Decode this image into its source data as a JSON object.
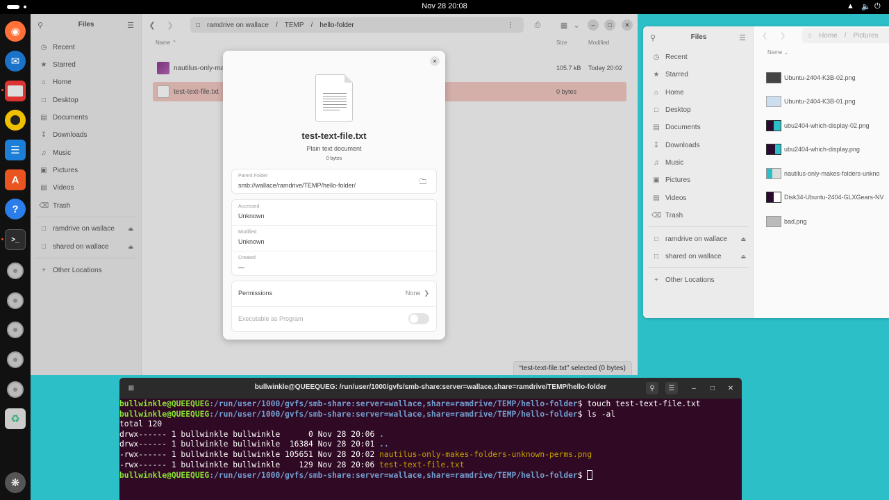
{
  "topbar": {
    "clock": "Nov 28  20:08",
    "icons": [
      "network-icon",
      "volume-icon",
      "power-icon"
    ]
  },
  "dock": {
    "apps": [
      "firefox-icon",
      "thunderbird-icon",
      "files-icon",
      "rhythmbox-icon",
      "writer-icon",
      "app-center-icon",
      "help-icon",
      "terminal-icon",
      "disc-icon",
      "disc-icon",
      "disc-icon",
      "disc-icon",
      "disc-icon",
      "trash-icon",
      "show-apps-icon"
    ]
  },
  "files_left": {
    "sidebar_title": "Files",
    "nav": [
      "Recent",
      "Starred",
      "Home",
      "Desktop",
      "Documents",
      "Downloads",
      "Music",
      "Pictures",
      "Videos",
      "Trash"
    ],
    "mounts": [
      "ramdrive on wallace",
      "shared on wallace"
    ],
    "other": "Other Locations",
    "path": [
      "ramdrive on wallace",
      "TEMP",
      "hello-folder"
    ],
    "columns": {
      "name": "Name",
      "size": "Size",
      "modified": "Modified"
    },
    "rows": [
      {
        "name": "nautilus-only-ma",
        "size": "105.7 kB",
        "modified": "Today 20:02"
      },
      {
        "name": "test-text-file.txt",
        "size": "0 bytes",
        "modified": ""
      }
    ],
    "status": "“test-text-file.txt” selected  (0 bytes)"
  },
  "properties": {
    "file_name": "test-text-file.txt",
    "file_type": "Plain text document",
    "file_size": "0 bytes",
    "parent_folder_label": "Parent Folder",
    "parent_folder": "smb://wallace/ramdrive/TEMP/hello-folder/",
    "accessed_label": "Accessed",
    "accessed": "Unknown",
    "modified_label": "Modified",
    "modified": "Unknown",
    "created_label": "Created",
    "created": "—",
    "permissions_label": "Permissions",
    "permissions_value": "None",
    "executable_label": "Executable as Program"
  },
  "files_right": {
    "sidebar_title": "Files",
    "nav": [
      "Recent",
      "Starred",
      "Home",
      "Desktop",
      "Documents",
      "Downloads",
      "Music",
      "Pictures",
      "Videos",
      "Trash"
    ],
    "mounts": [
      "ramdrive on wallace",
      "shared on wallace"
    ],
    "other": "Other Locations",
    "path": [
      "Home",
      "Pictures"
    ],
    "column": "Name",
    "rows": [
      "Ubuntu-2404-K3B-02.png",
      "Ubuntu-2404-K3B-01.png",
      "ubu2404-which-display-02.png",
      "ubu2404-which-display.png",
      "nautilus-only-makes-folders-unkno",
      "Disk34-Ubuntu-2404-GLXGears-NV",
      "bad.png"
    ]
  },
  "terminal": {
    "title": "bullwinkle@QUEEQUEG: /run/user/1000/gvfs/smb-share:server=wallace,share=ramdrive/TEMP/hello-folder",
    "user": "bullwinkle@QUEEQUEG",
    "cwd": ":/run/user/1000/gvfs/smb-share:server=wallace,share=ramdrive/TEMP/hello-folder",
    "cmd1": "$ touch test-text-file.txt",
    "cmd2": "$ ls -al",
    "cmd3": "$ ",
    "total": "total 120",
    "ls_rows": [
      {
        "meta": "drwx------ 1 bullwinkle bullwinkle      0 Nov 28 20:06 ",
        "name": "."
      },
      {
        "meta": "drwx------ 1 bullwinkle bullwinkle  16384 Nov 28 20:01 ",
        "name": ".."
      },
      {
        "meta": "-rwx------ 1 bullwinkle bullwinkle 105651 Nov 28 20:02 ",
        "name": "nautilus-only-makes-folders-unknown-perms.png"
      },
      {
        "meta": "-rwx------ 1 bullwinkle bullwinkle    129 Nov 28 20:06 ",
        "name": "test-text-file.txt"
      }
    ]
  }
}
